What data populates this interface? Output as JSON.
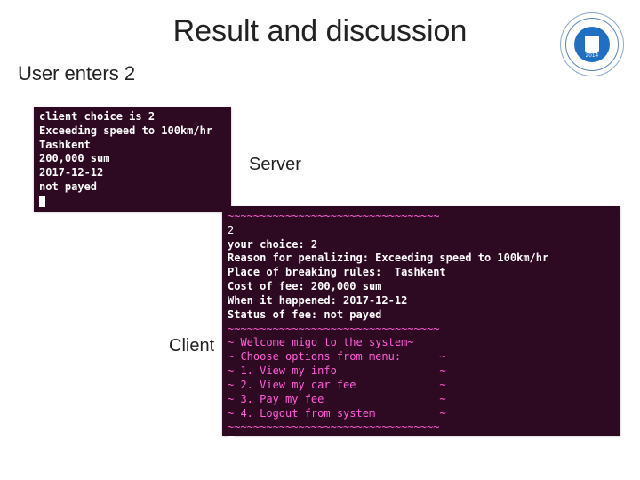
{
  "title": "Result and discussion",
  "subtitle": "User enters 2",
  "labels": {
    "server": "Server",
    "client": "Client"
  },
  "logo": {
    "year": "2014"
  },
  "server_terminal": {
    "lines": [
      "client choice is 2",
      "Exceeding speed to 100km/hr",
      "Tashkent",
      "200,000 sum",
      "2017-12-12",
      "not payed"
    ]
  },
  "client_terminal": {
    "sep1": "~~~~~~~~~~~~~~~~~~~~~~~~~~~~~~~~~",
    "input": "2",
    "choice": "your choice: 2",
    "reason": "Reason for penalizing: Exceeding speed to 100km/hr",
    "place": "Place of breaking rules:  Tashkent",
    "cost": "Cost of fee: 200,000 sum",
    "when": "When it happened: 2017-12-12",
    "status": "Status of fee: not payed",
    "sep2": "~~~~~~~~~~~~~~~~~~~~~~~~~~~~~~~~~",
    "menu": [
      "~ Welcome migo to the system~",
      "~ Choose options from menu:      ~",
      "~ 1. View my info                ~",
      "~ 2. View my car fee             ~",
      "~ 3. Pay my fee                  ~",
      "~ 4. Logout from system          ~"
    ],
    "sep3": "~~~~~~~~~~~~~~~~~~~~~~~~~~~~~~~~~"
  }
}
